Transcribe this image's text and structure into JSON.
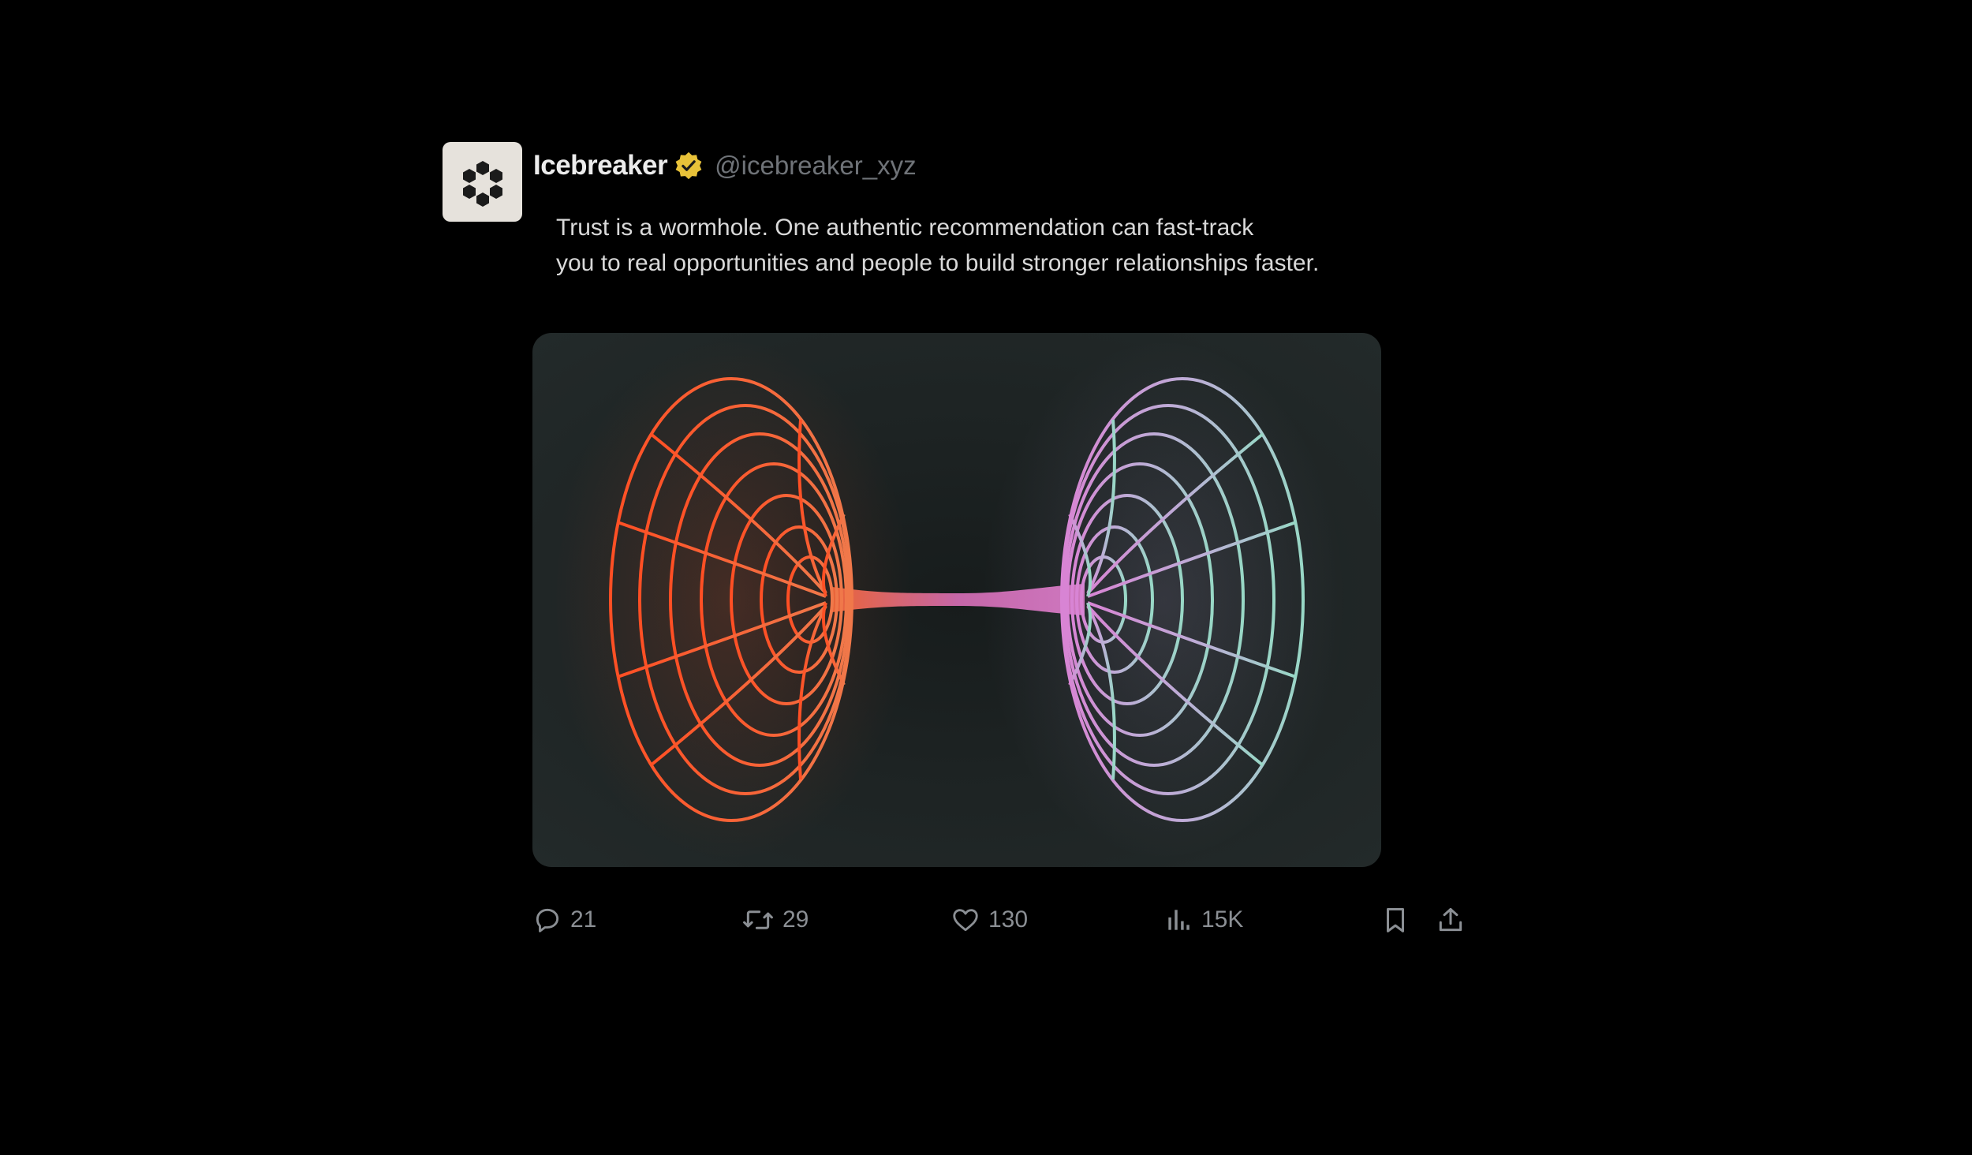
{
  "author": {
    "display_name": "Icebreaker",
    "handle": "@icebreaker_xyz",
    "verified_badge_icon": "verified-badge-icon",
    "avatar_icon": "hexagon-cluster-logo-icon",
    "verified_color": "#e8c239"
  },
  "tweet": {
    "text_line_1": "Trust is a wormhole. One authentic recommendation can fast-track",
    "text_line_2": "you to real opportunities and people to build stronger relationships faster.",
    "media_icon": "wormhole-illustration"
  },
  "actions": {
    "reply": {
      "icon": "reply-icon",
      "count": "21"
    },
    "retweet": {
      "icon": "retweet-icon",
      "count": "29"
    },
    "like": {
      "icon": "heart-icon",
      "count": "130"
    },
    "views": {
      "icon": "views-chart-icon",
      "count": "15K"
    },
    "bookmark": {
      "icon": "bookmark-icon"
    },
    "share": {
      "icon": "share-icon"
    }
  },
  "colors": {
    "background": "#000000",
    "wormhole_left": "#ff5a2e",
    "wormhole_middle": "#d974c8",
    "wormhole_right": "#9fd6c8"
  }
}
